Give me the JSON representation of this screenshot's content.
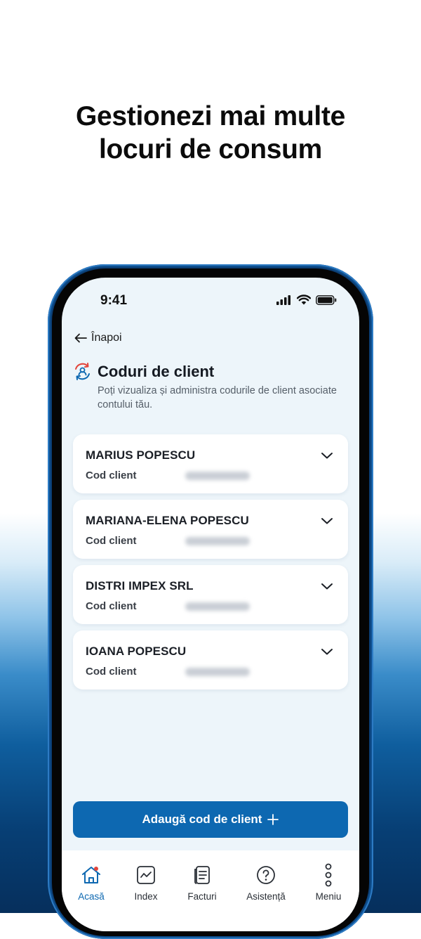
{
  "headline": {
    "line1": "Gestionezi mai multe",
    "line2": "locuri de consum"
  },
  "status": {
    "time": "9:41"
  },
  "nav": {
    "back_label": "Înapoi"
  },
  "section": {
    "title": "Coduri de client",
    "description": "Poți vizualiza și administra codurile de client asociate contului tău."
  },
  "clients": [
    {
      "name": "MARIUS POPESCU",
      "code_label": "Cod client"
    },
    {
      "name": "MARIANA-ELENA POPESCU",
      "code_label": "Cod client"
    },
    {
      "name": "DISTRI IMPEX SRL",
      "code_label": "Cod client"
    },
    {
      "name": "IOANA POPESCU",
      "code_label": "Cod client"
    }
  ],
  "add_button": {
    "label": "Adaugă cod de client",
    "icon": "plus-icon"
  },
  "tabs": [
    {
      "label": "Acasă",
      "icon": "home-icon",
      "active": true
    },
    {
      "label": "Index",
      "icon": "chart-icon",
      "active": false
    },
    {
      "label": "Facturi",
      "icon": "invoice-icon",
      "active": false
    },
    {
      "label": "Asistență",
      "icon": "help-icon",
      "active": false
    },
    {
      "label": "Meniu",
      "icon": "more-icon",
      "active": false
    }
  ],
  "colors": {
    "accent": "#0d68b1",
    "screen_bg": "#edf5fa",
    "phone_frame": "#0b3d73",
    "icon_red": "#e2453b"
  }
}
